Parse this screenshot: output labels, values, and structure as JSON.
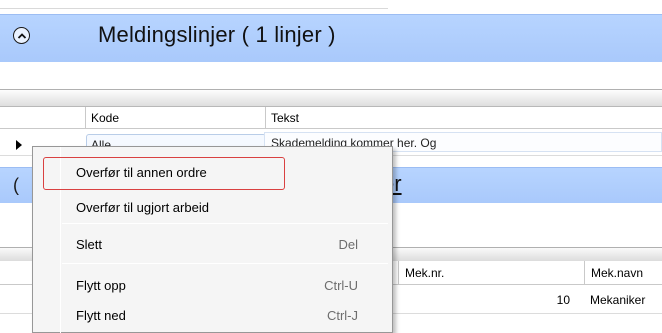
{
  "section1": {
    "title": "Meldingslinjer  ( 1 linjer )",
    "collapse_icon": "chevron-up-circle-icon"
  },
  "grid1": {
    "columns": [
      "Kode",
      "Tekst"
    ],
    "rows": [
      {
        "kode": "Alle",
        "tekst": "Skademelding kommer her. Og"
      }
    ]
  },
  "section2": {
    "title_fragment": "er",
    "left_fragment": "("
  },
  "grid2": {
    "columns": [
      "Mek.nr.",
      "Mek.navn"
    ],
    "rows": [
      {
        "mek_nr": "10",
        "mek_navn": "Mekaniker"
      }
    ]
  },
  "context_menu": {
    "items": [
      {
        "label": "Overfør til annen ordre",
        "shortcut": ""
      },
      {
        "label": "Overfør til ugjort arbeid",
        "shortcut": ""
      },
      {
        "label": "Slett",
        "shortcut": "Del"
      },
      {
        "label": "Flytt opp",
        "shortcut": "Ctrl-U"
      },
      {
        "label": "Flytt ned",
        "shortcut": "Ctrl-J"
      }
    ]
  },
  "colors": {
    "band": "#b7d4ff",
    "highlight": "#d94141"
  }
}
